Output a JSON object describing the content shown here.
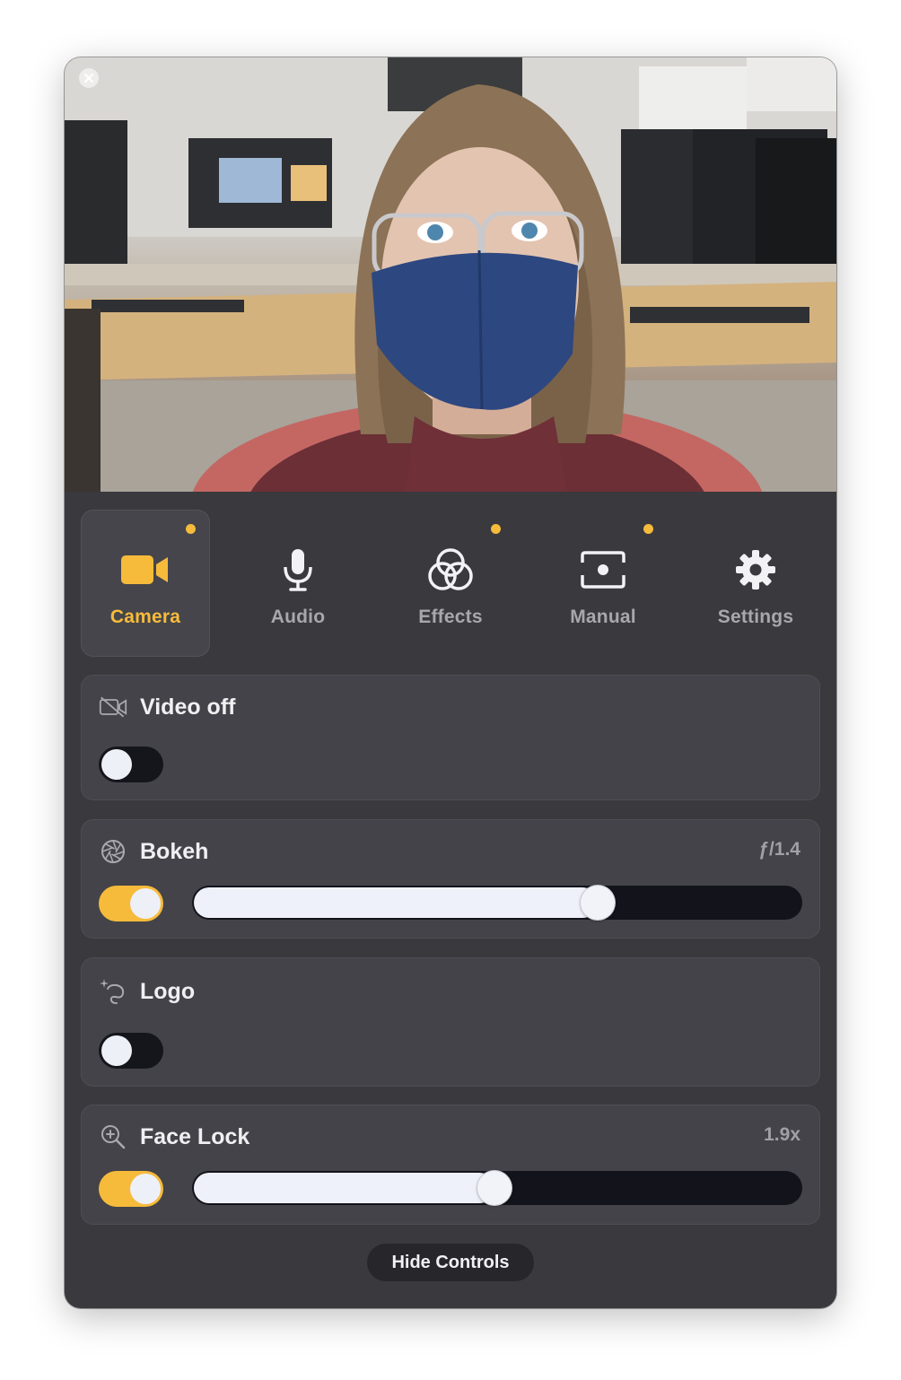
{
  "window": {
    "preview": {
      "description_icon": "camera-preview"
    }
  },
  "tabs": [
    {
      "id": "camera",
      "label": "Camera",
      "active": true,
      "badge": true,
      "icon": "video-camera-icon"
    },
    {
      "id": "audio",
      "label": "Audio",
      "active": false,
      "badge": false,
      "icon": "microphone-icon"
    },
    {
      "id": "effects",
      "label": "Effects",
      "active": false,
      "badge": true,
      "icon": "effects-circles-icon"
    },
    {
      "id": "manual",
      "label": "Manual",
      "active": false,
      "badge": true,
      "icon": "manual-frame-icon"
    },
    {
      "id": "settings",
      "label": "Settings",
      "active": false,
      "badge": false,
      "icon": "gear-icon"
    }
  ],
  "cards": {
    "video_off": {
      "title": "Video off",
      "enabled": false
    },
    "bokeh": {
      "title": "Bokeh",
      "value_label": "ƒ/1.4",
      "enabled": true,
      "level": 0.665
    },
    "logo": {
      "title": "Logo",
      "enabled": false
    },
    "face_lock": {
      "title": "Face Lock",
      "value_label": "1.9x",
      "enabled": true,
      "level": 0.495
    }
  },
  "footer": {
    "hide_controls_label": "Hide Controls"
  },
  "colors": {
    "accent": "#f6bb3a",
    "panel": "#39393e",
    "card": "#434349",
    "track": "#13131b"
  }
}
